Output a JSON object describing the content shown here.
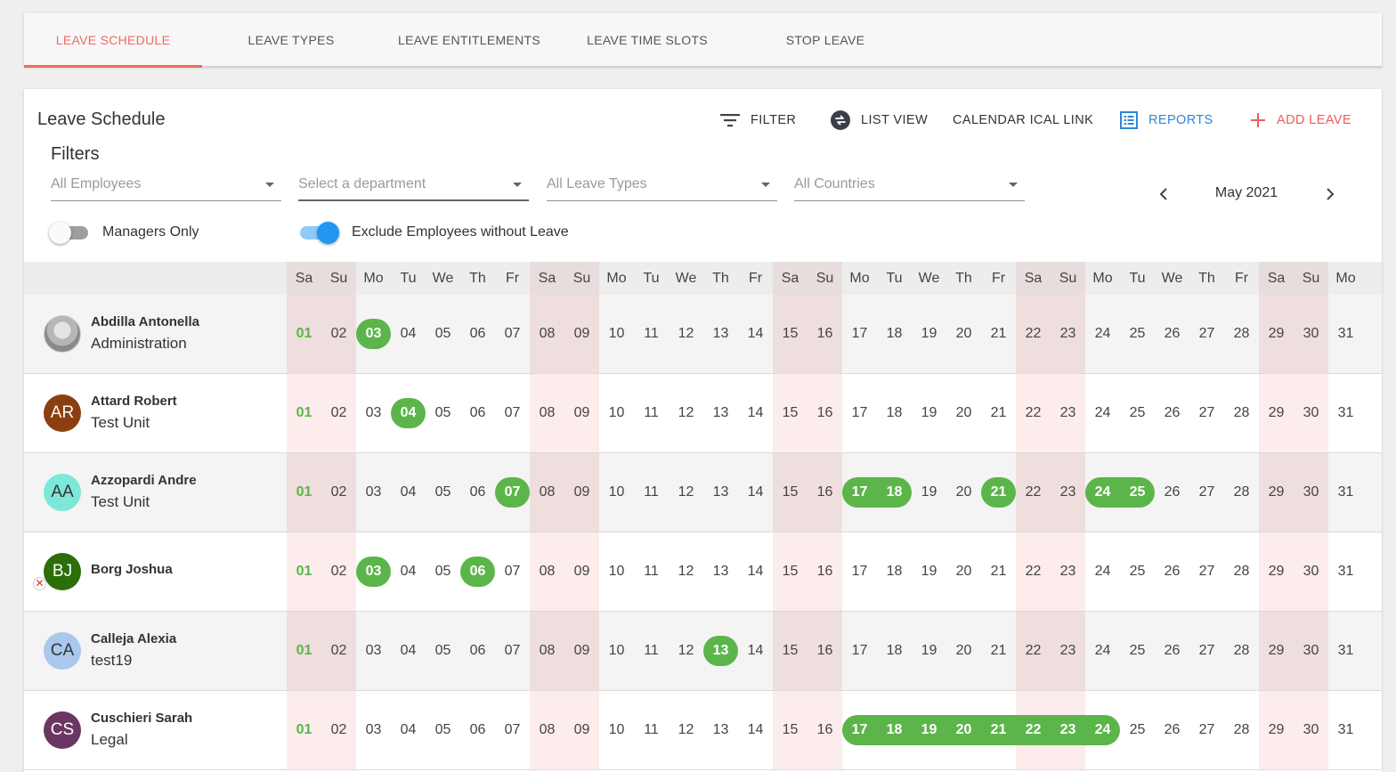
{
  "tabs": [
    {
      "label": "LEAVE SCHEDULE",
      "active": true
    },
    {
      "label": "LEAVE TYPES",
      "active": false
    },
    {
      "label": "LEAVE ENTITLEMENTS",
      "active": false
    },
    {
      "label": "LEAVE TIME SLOTS",
      "active": false
    },
    {
      "label": "STOP LEAVE",
      "active": false
    }
  ],
  "card": {
    "title": "Leave Schedule",
    "toolbar": {
      "filter": "FILTER",
      "list_view": "LIST VIEW",
      "calendar_ical": "CALENDAR ICAL LINK",
      "reports": "REPORTS",
      "add_leave": "ADD LEAVE"
    },
    "filters_title": "Filters",
    "selects": {
      "employees": "All Employees",
      "department": "Select a department",
      "leave_types": "All Leave Types",
      "countries": "All Countries"
    },
    "month": "May 2021",
    "toggles": {
      "managers_only": {
        "label": "Managers Only",
        "on": false
      },
      "exclude_without_leave": {
        "label": "Exclude Employees without Leave",
        "on": true
      }
    }
  },
  "colors": {
    "accent": "#ee6b61",
    "leave": "#5cb54a",
    "blue": "#2f86d8",
    "switch_on": "#2196f3"
  },
  "days": [
    {
      "n": "01",
      "d": "Sa",
      "we": true
    },
    {
      "n": "02",
      "d": "Su",
      "we": true
    },
    {
      "n": "03",
      "d": "Mo"
    },
    {
      "n": "04",
      "d": "Tu"
    },
    {
      "n": "05",
      "d": "We"
    },
    {
      "n": "06",
      "d": "Th"
    },
    {
      "n": "07",
      "d": "Fr"
    },
    {
      "n": "08",
      "d": "Sa",
      "we": true
    },
    {
      "n": "09",
      "d": "Su",
      "we": true
    },
    {
      "n": "10",
      "d": "Mo"
    },
    {
      "n": "11",
      "d": "Tu"
    },
    {
      "n": "12",
      "d": "We"
    },
    {
      "n": "13",
      "d": "Th"
    },
    {
      "n": "14",
      "d": "Fr"
    },
    {
      "n": "15",
      "d": "Sa",
      "we": true
    },
    {
      "n": "16",
      "d": "Su",
      "we": true
    },
    {
      "n": "17",
      "d": "Mo"
    },
    {
      "n": "18",
      "d": "Tu"
    },
    {
      "n": "19",
      "d": "We"
    },
    {
      "n": "20",
      "d": "Th"
    },
    {
      "n": "21",
      "d": "Fr"
    },
    {
      "n": "22",
      "d": "Sa",
      "we": true
    },
    {
      "n": "23",
      "d": "Su",
      "we": true
    },
    {
      "n": "24",
      "d": "Mo"
    },
    {
      "n": "25",
      "d": "Tu"
    },
    {
      "n": "26",
      "d": "We"
    },
    {
      "n": "27",
      "d": "Th"
    },
    {
      "n": "28",
      "d": "Fr"
    },
    {
      "n": "29",
      "d": "Sa",
      "we": true
    },
    {
      "n": "30",
      "d": "Su",
      "we": true
    },
    {
      "n": "31",
      "d": "Mo"
    }
  ],
  "employees": [
    {
      "name": "Abdilla Antonella",
      "dept": "Administration",
      "initials": "",
      "photo": true,
      "avatar_color": "#9a9a9a",
      "leave": [
        [
          3,
          3
        ]
      ]
    },
    {
      "name": "Attard Robert",
      "dept": "Test Unit",
      "initials": "AR",
      "avatar_color": "#8b3e0f",
      "leave": [
        [
          4,
          4
        ]
      ]
    },
    {
      "name": "Azzopardi Andre",
      "dept": "Test Unit",
      "initials": "AA",
      "avatar_color": "#7ee8d8",
      "avatar_text": "#333",
      "leave": [
        [
          7,
          7
        ],
        [
          17,
          18
        ],
        [
          21,
          21
        ],
        [
          24,
          25
        ]
      ]
    },
    {
      "name": "Borg Joshua",
      "dept": "",
      "initials": "BJ",
      "avatar_color": "#2c6e0a",
      "badge": true,
      "leave": [
        [
          3,
          3
        ],
        [
          6,
          6
        ]
      ]
    },
    {
      "name": "Calleja Alexia",
      "dept": "test19",
      "initials": "CA",
      "avatar_color": "#a9c8ec",
      "avatar_text": "#333",
      "leave": [
        [
          13,
          13
        ]
      ]
    },
    {
      "name": "Cuschieri Sarah",
      "dept": "Legal",
      "initials": "CS",
      "avatar_color": "#6b3663",
      "leave": [
        [
          17,
          24
        ]
      ]
    }
  ]
}
